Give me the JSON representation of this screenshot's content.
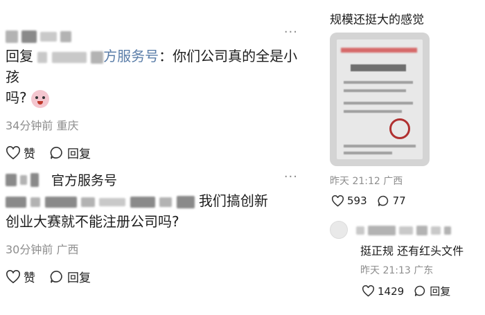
{
  "comments": [
    {
      "reply_prefix": "回复",
      "reply_target_suffix": "方服务号",
      "reply_text": "：你们公司真的全是小孩",
      "reply_text_line2": "吗?",
      "emoji": "crying-face-emoji",
      "time": "34分钟前",
      "location": "重庆",
      "like_label": "赞",
      "reply_label": "回复"
    },
    {
      "author_suffix": "官方服务号",
      "text_line1": "我们搞创新",
      "text_line2": "创业大赛就不能注册公司吗?",
      "time": "30分钟前",
      "location": "广西",
      "like_label": "赞",
      "reply_label": "回复"
    }
  ],
  "post": {
    "title": "规模还挺大的感觉",
    "time": "昨天 21:12",
    "location": "广西",
    "likes": "593",
    "replies": "77"
  },
  "sub_reply": {
    "text": "挺正规 还有红头文件",
    "time": "昨天 21:13",
    "location": "广东",
    "likes": "1429",
    "reply_label": "回复"
  },
  "more_label": "···",
  "colors": {
    "meta_gray": "#8d8d8d",
    "text": "#1d1d1d",
    "reply_link": "#5a7da8"
  }
}
